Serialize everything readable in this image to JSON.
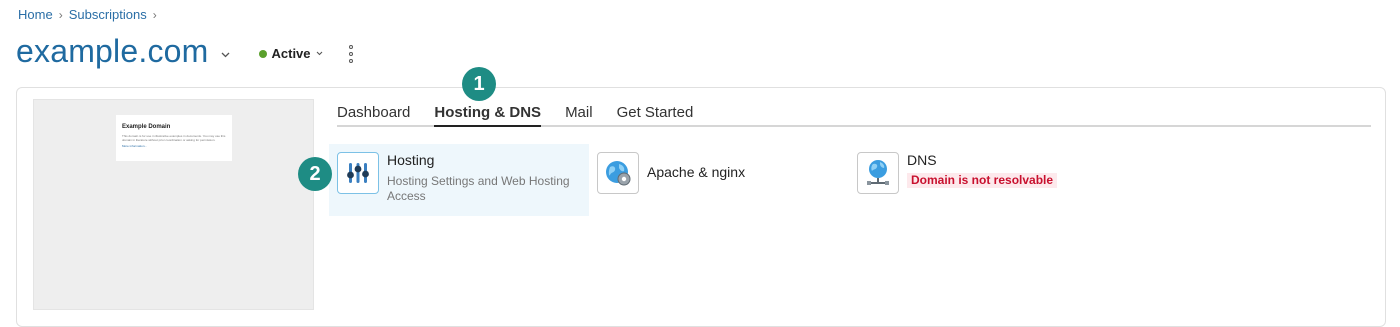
{
  "breadcrumb": {
    "home": "Home",
    "subscriptions": "Subscriptions",
    "separator": ">"
  },
  "header": {
    "title": "example.com",
    "status": "Active",
    "status_color": "#5aa02c"
  },
  "preview": {
    "heading": "Example Domain",
    "body": "This domain is for use in illustrative examples in documents. You may use this domain in literature without prior coordination or asking for permission.",
    "link": "More information..."
  },
  "tabs": [
    {
      "label": "Dashboard"
    },
    {
      "label": "Hosting & DNS"
    },
    {
      "label": "Mail"
    },
    {
      "label": "Get Started"
    }
  ],
  "badges": {
    "first": "1",
    "second": "2",
    "color": "#1e8c84"
  },
  "tiles": [
    {
      "title": "Hosting",
      "desc": "Hosting Settings and Web Hosting Access",
      "icon": "hosting-settings-icon"
    },
    {
      "title": "Apache & nginx",
      "icon": "apache-nginx-globe-icon"
    },
    {
      "title": "DNS",
      "warning": "Domain is not resolvable",
      "icon": "dns-globe-icon"
    }
  ]
}
